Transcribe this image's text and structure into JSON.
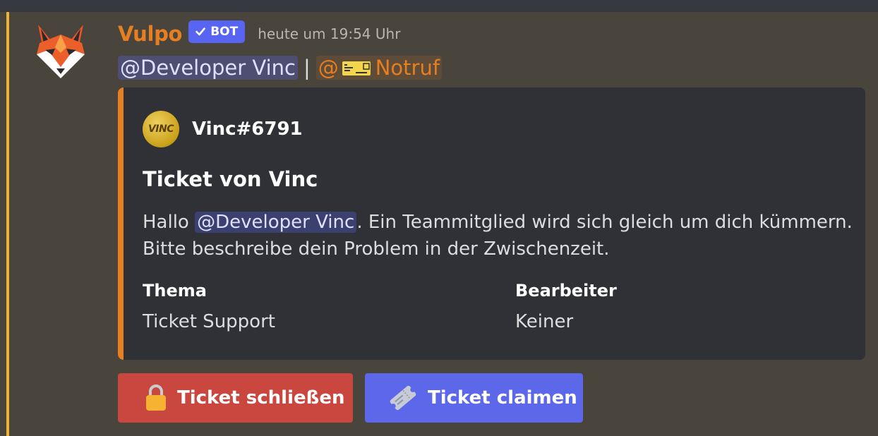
{
  "message": {
    "author": "Vulpo",
    "bot_tag": "BOT",
    "timestamp": "heute um 19:54 Uhr",
    "content": {
      "user_mention": "@Developer Vinc",
      "separator": "|",
      "role_mention_prefix": "@",
      "role_mention_name": "Notruf"
    },
    "colors": {
      "author": "#e67e22",
      "mention_bar": "#f0b232",
      "embed_accent": "#e67e22",
      "bot_tag": "#5865f2"
    }
  },
  "embed": {
    "author_icon_text": "VINC",
    "author_name": "Vinc#6791",
    "title": "Ticket von Vinc",
    "description": {
      "prefix": "Hallo ",
      "mention": "@Developer Vinc",
      "suffix": ". Ein Teammitglied wird sich gleich um dich kümmern. Bitte beschreibe dein Problem in der Zwischenzeit."
    },
    "fields": [
      {
        "name": "Thema",
        "value": "Ticket Support"
      },
      {
        "name": "Bearbeiter",
        "value": "Keiner"
      }
    ]
  },
  "buttons": [
    {
      "label": "Ticket schließen",
      "icon": "lock-icon",
      "color": "#c9473f"
    },
    {
      "label": "Ticket claimen",
      "icon": "ticket-icon",
      "color": "#5c67e9"
    }
  ]
}
